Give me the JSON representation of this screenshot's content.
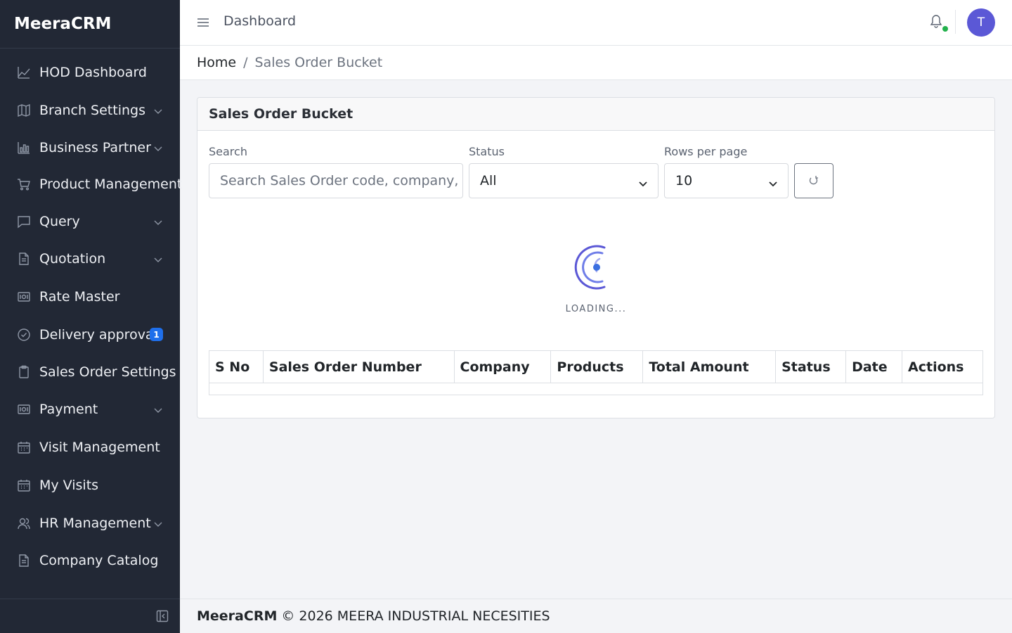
{
  "brand": "MeeraCRM",
  "sidebar": {
    "items": [
      {
        "label": "HOD Dashboard",
        "icon": "chart-line-icon",
        "has_submenu": false
      },
      {
        "label": "Branch Settings",
        "icon": "map-icon",
        "has_submenu": true
      },
      {
        "label": "Business Partner",
        "icon": "bar-chart-icon",
        "has_submenu": true
      },
      {
        "label": "Product Management",
        "icon": "cart-icon",
        "has_submenu": false
      },
      {
        "label": "Query",
        "icon": "message-square-icon",
        "has_submenu": true
      },
      {
        "label": "Quotation",
        "icon": "document-icon",
        "has_submenu": true
      },
      {
        "label": "Rate Master",
        "icon": "cash-icon",
        "has_submenu": false
      },
      {
        "label": "Delivery approval",
        "icon": "check-circle-icon",
        "has_submenu": false,
        "badge": "1"
      },
      {
        "label": "Sales Order Settings",
        "icon": "clipboard-icon",
        "has_submenu": false
      },
      {
        "label": "Payment",
        "icon": "cash-icon",
        "has_submenu": true
      },
      {
        "label": "Visit Management",
        "icon": "calendar-icon",
        "has_submenu": false
      },
      {
        "label": "My Visits",
        "icon": "calendar-icon",
        "has_submenu": false
      },
      {
        "label": "HR Management",
        "icon": "users-icon",
        "has_submenu": true
      },
      {
        "label": "Company Catalog",
        "icon": "document-icon",
        "has_submenu": false
      }
    ]
  },
  "header": {
    "title": "Dashboard",
    "avatar_initial": "T",
    "notification_status_color": "#22b14c"
  },
  "breadcrumb": {
    "home": "Home",
    "separator": "/",
    "current": "Sales Order Bucket"
  },
  "card": {
    "title": "Sales Order Bucket",
    "search": {
      "label": "Search",
      "placeholder": "Search Sales Order code, company, p",
      "value": ""
    },
    "status": {
      "label": "Status",
      "selected": "All"
    },
    "rows_per_page": {
      "label": "Rows per page",
      "selected": "10"
    },
    "loading_text": "LOADING...",
    "table": {
      "columns": [
        "S No",
        "Sales Order Number",
        "Company",
        "Products",
        "Total Amount",
        "Status",
        "Date",
        "Actions"
      ],
      "rows": []
    }
  },
  "footer": {
    "brand": "MeeraCRM",
    "text": "© 2026 MEERA INDUSTRIAL NECESITIES"
  },
  "colors": {
    "sidebar_bg": "#222835",
    "accent": "#5b58d6",
    "badge": "#1f6feb"
  }
}
